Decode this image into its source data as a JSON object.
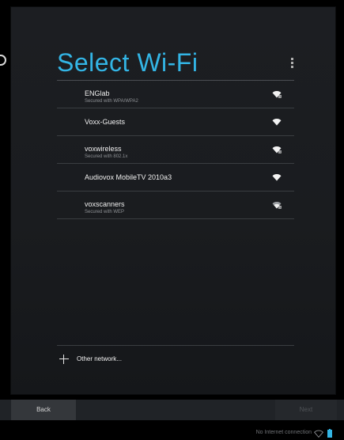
{
  "header": {
    "title": "Select Wi-Fi",
    "menu_icon": "overflow-menu-icon"
  },
  "accent_color": "#33b5e5",
  "networks": [
    {
      "name": "ENGlab",
      "security": "Secured with WPA/WPA2",
      "icon": "wifi-locked-icon"
    },
    {
      "name": "Voxx-Guests",
      "security": "",
      "icon": "wifi-icon"
    },
    {
      "name": "voxwireless",
      "security": "Secured with 802.1x",
      "icon": "wifi-locked-icon"
    },
    {
      "name": "Audiovox MobileTV 2010a3",
      "security": "",
      "icon": "wifi-icon"
    },
    {
      "name": "voxscanners",
      "security": "Secured with WEP",
      "icon": "wifi-locked-icon"
    }
  ],
  "other_network": {
    "label": "Other network...",
    "icon": "plus-icon"
  },
  "buttons": {
    "back": "Back",
    "next": "Next"
  },
  "status_bar": {
    "text": "No Internet connection",
    "wifi_icon": "wifi-outline-icon",
    "battery_icon": "battery-icon"
  }
}
